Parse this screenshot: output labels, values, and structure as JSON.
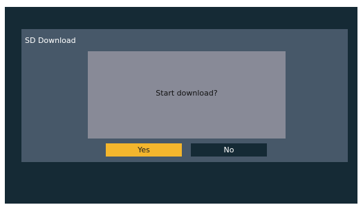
{
  "panel": {
    "title": "SD Download"
  },
  "dialog": {
    "message": "Start download?"
  },
  "buttons": {
    "yes_label": "Yes",
    "no_label": "No",
    "selected": "Yes"
  },
  "colors": {
    "screen_background": "#152a35",
    "panel_background": "#475869",
    "dialog_background": "#888a97",
    "selected_button": "#f4b62d",
    "unselected_button": "#152a35"
  }
}
